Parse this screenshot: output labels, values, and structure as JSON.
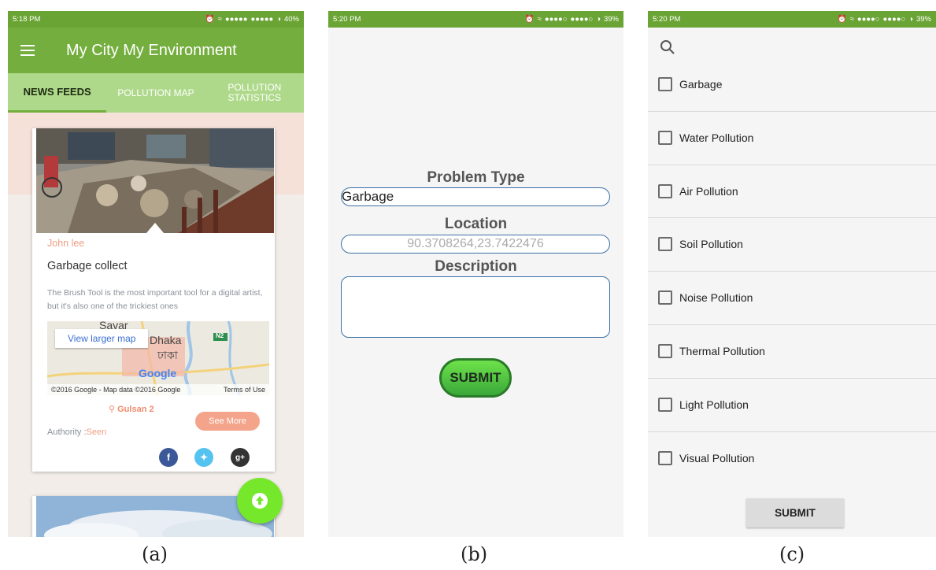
{
  "screens": {
    "a": {
      "status": {
        "time": "5:18 PM",
        "battery": "40%"
      },
      "app_title": "My City My Environment",
      "tabs": [
        "NEWS FEEDS",
        "POLLUTION MAP",
        "POLLUTION STATISTICS"
      ],
      "card": {
        "author": "John lee",
        "title": "Garbage collect",
        "description": "The Brush Tool is the most important tool for a digital artist, but it's also one of the trickiest ones",
        "map": {
          "button": "View larger map",
          "places": [
            "Savar",
            "Dhaka",
            "ঢাকা"
          ],
          "logo": "Google",
          "road_label": "N2",
          "attribution": "©2016 Google - Map data ©2016 Google",
          "terms": "Terms of Use"
        },
        "location": "Gulsan 2",
        "see_more": "See More",
        "authority_label": "Authority :",
        "authority_value": "Seen"
      }
    },
    "b": {
      "status": {
        "time": "5:20 PM",
        "battery": "39%"
      },
      "problem_type_label": "Problem Type",
      "problem_type_value": "Garbage",
      "location_label": "Location",
      "location_value": "90.3708264,23.7422476",
      "description_label": "Description",
      "submit": "SUBMIT"
    },
    "c": {
      "status": {
        "time": "5:20 PM",
        "battery": "39%"
      },
      "options": [
        "Garbage",
        "Water Pollution",
        "Air Pollution",
        "Soil Pollution",
        "Noise Pollution",
        "Thermal Pollution",
        "Light Pollution",
        "Visual Pollution"
      ],
      "submit": "SUBMIT"
    }
  },
  "captions": [
    "(a)",
    "(b)",
    "(c)"
  ],
  "colors": {
    "primary": "#74ae3e",
    "tab_bar": "#aed98a",
    "accent": "#ef9d82",
    "fab": "#76e82b"
  }
}
